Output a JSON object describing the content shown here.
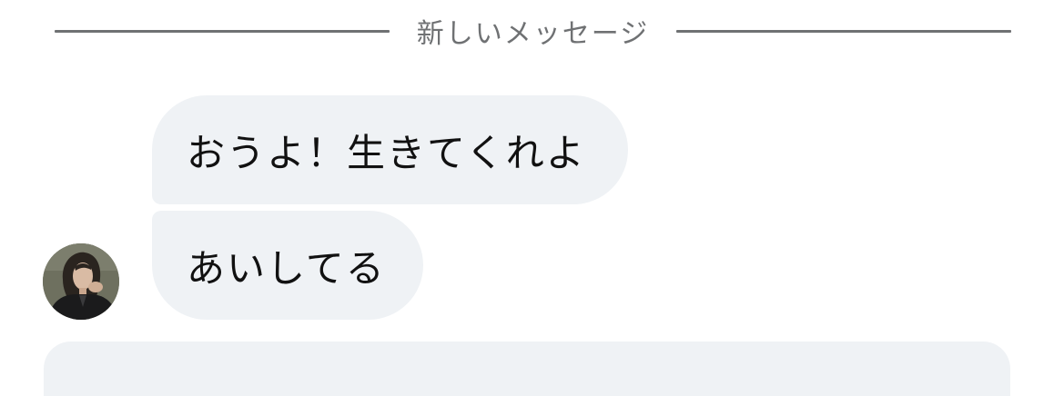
{
  "divider": {
    "label": "新しいメッセージ"
  },
  "conversation": {
    "messages": [
      {
        "text": "おうよ！生きてくれよ"
      },
      {
        "text": "あいしてる"
      }
    ]
  },
  "colors": {
    "bubble_background": "#eff2f5",
    "divider_color": "#6f7173",
    "message_text": "#111111"
  }
}
